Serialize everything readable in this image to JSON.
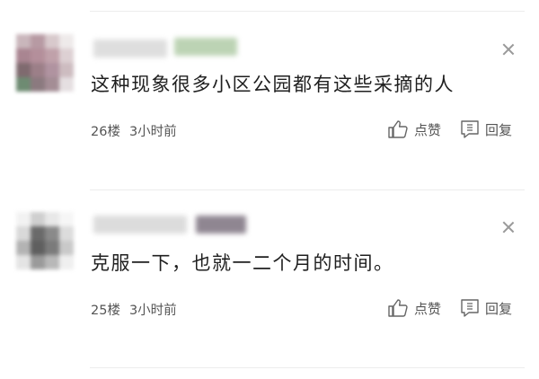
{
  "comments": [
    {
      "text": "这种现象很多小区公园都有这些采摘的人",
      "floor": "26楼",
      "time": "3小时前",
      "like_label": "点赞",
      "reply_label": "回复",
      "avatar_colors": [
        "#b79aa3",
        "#a98591",
        "#7f6a6f",
        "#6e8b72"
      ]
    },
    {
      "text": "克服一下，也就一二个月的时间。",
      "floor": "25楼",
      "time": "3小时前",
      "like_label": "点赞",
      "reply_label": "回复",
      "avatar_colors": [
        "#d9d9d9",
        "#8a8a8a",
        "#5f5f5f",
        "#b3b3b3"
      ]
    }
  ],
  "icons": {
    "close": "close-icon",
    "like": "thumbs-up-icon",
    "reply": "reply-icon"
  },
  "colors": {
    "text": "#1f1f1f",
    "meta": "#555555",
    "divider": "#ececec",
    "icon": "#9a9a9a"
  }
}
